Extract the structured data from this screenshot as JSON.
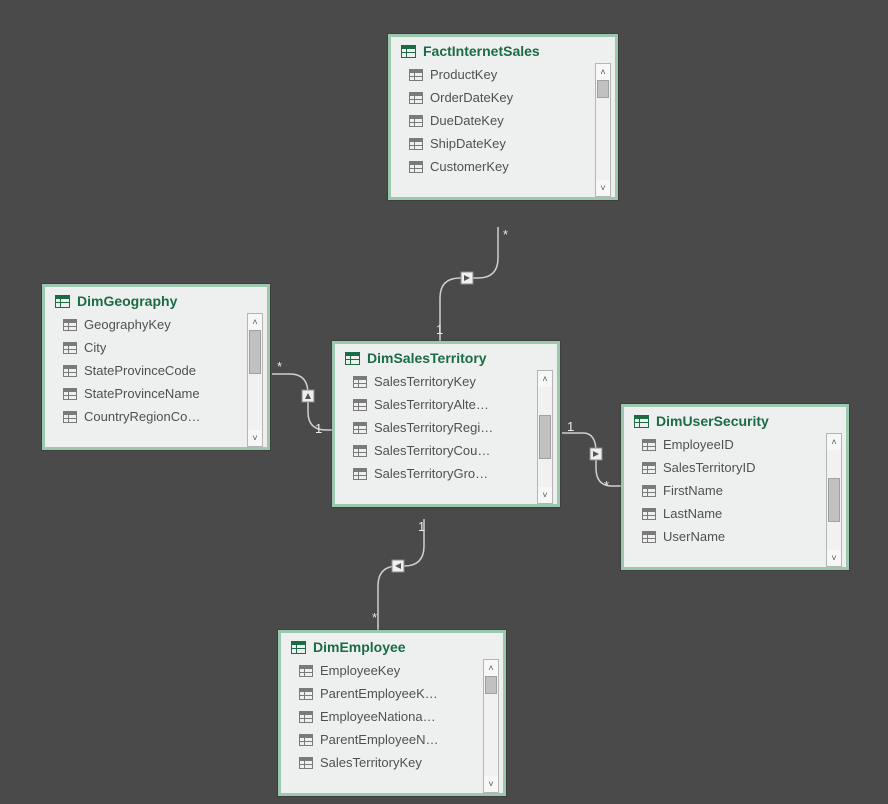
{
  "tables": {
    "factInternetSales": {
      "title": "FactInternetSales",
      "fields": [
        "ProductKey",
        "OrderDateKey",
        "DueDateKey",
        "ShipDateKey",
        "CustomerKey"
      ]
    },
    "dimGeography": {
      "title": "DimGeography",
      "fields": [
        "GeographyKey",
        "City",
        "StateProvinceCode",
        "StateProvinceName",
        "CountryRegionCo…"
      ]
    },
    "dimSalesTerritory": {
      "title": "DimSalesTerritory",
      "fields": [
        "SalesTerritoryKey",
        "SalesTerritoryAlte…",
        "SalesTerritoryRegi…",
        "SalesTerritoryCou…",
        "SalesTerritoryGro…"
      ]
    },
    "dimUserSecurity": {
      "title": "DimUserSecurity",
      "fields": [
        "EmployeeID",
        "SalesTerritoryID",
        "FirstName",
        "LastName",
        "UserName"
      ]
    },
    "dimEmployee": {
      "title": "DimEmployee",
      "fields": [
        "EmployeeKey",
        "ParentEmployeeK…",
        "EmployeeNationa…",
        "ParentEmployeeN…",
        "SalesTerritoryKey"
      ]
    }
  },
  "cardinality": {
    "one": "1",
    "many": "*"
  }
}
